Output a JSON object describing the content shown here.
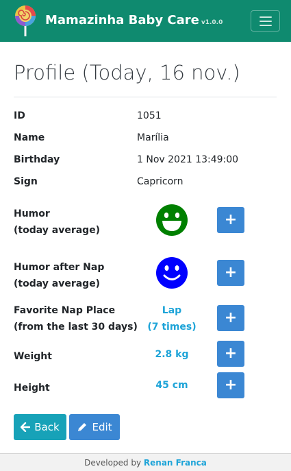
{
  "navbar": {
    "brand": "Mamazinha Baby Care",
    "version": "v1.0.0",
    "menu_icon": "hamburger-icon",
    "logo_icon": "lollipop-logo"
  },
  "page": {
    "title": "Profile (Today, 16 nov.)"
  },
  "profile": {
    "id_label": "ID",
    "id_value": "1051",
    "name_label": "Name",
    "name_value": "Marília",
    "birthday_label": "Birthday",
    "birthday_value": "1 Nov 2021 13:49:00",
    "sign_label": "Sign",
    "sign_value": "Capricorn"
  },
  "metrics": {
    "humor_label_1": "Humor",
    "humor_label_2": "(today average)",
    "humor_icon": "happy-face-icon",
    "humor_color": "#008000",
    "humor_nap_label_1": "Humor after Nap",
    "humor_nap_label_2": "(today average)",
    "humor_nap_icon": "smiling-face-icon",
    "humor_nap_color": "#0000ff",
    "nap_place_label_1": "Favorite Nap Place",
    "nap_place_label_2": "(from the last 30 days)",
    "nap_place_value_1": "Lap",
    "nap_place_value_2": "(7 times)",
    "weight_label": "Weight",
    "weight_value": "2.8 kg",
    "height_label": "Height",
    "height_value": "45 cm",
    "plus_label": "+"
  },
  "actions": {
    "back_label": "Back",
    "edit_label": "Edit"
  },
  "footer": {
    "prefix": "Developed by",
    "author": "Renan Franca"
  },
  "colors": {
    "navbar": "#0f8a6f",
    "accent_value": "#1ea4d8",
    "primary_button": "#3b87d3",
    "info_button": "#17a2b8"
  }
}
